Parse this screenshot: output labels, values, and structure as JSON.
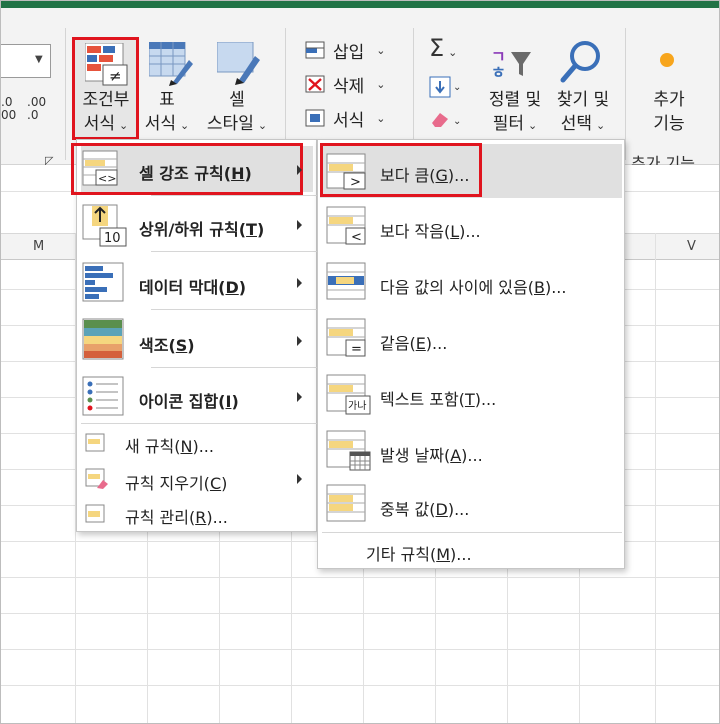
{
  "ribbon": {
    "decimal_increase": ".0\n00",
    "decimal_decrease": ".00\n→.0",
    "conditional_formatting": {
      "line1": "조건부",
      "line2": "서식"
    },
    "format_as_table": {
      "line1": "표",
      "line2": "서식"
    },
    "cell_styles": {
      "line1": "셀",
      "line2": "스타일"
    },
    "insert": "삽입",
    "delete": "삭제",
    "format": "서식",
    "sigma": "Σ",
    "sort_filter": {
      "line1": "정렬 및",
      "line2": "필터"
    },
    "find_select": {
      "line1": "찾기 및",
      "line2": "선택"
    },
    "addins": {
      "line1": "추가",
      "line2": "기능"
    },
    "addins_group_label": "추가 기능"
  },
  "columns": {
    "m": "M",
    "v": "V"
  },
  "menu_main": {
    "highlight_rules": {
      "label": "셀 강조 규칙(",
      "key": "H",
      "end": ")"
    },
    "top_bottom": {
      "label": "상위/하위 규칙(",
      "key": "T",
      "end": ")"
    },
    "data_bars": {
      "label": "데이터 막대(",
      "key": "D",
      "end": ")"
    },
    "color_scales": {
      "label": "색조(",
      "key": "S",
      "end": ")"
    },
    "icon_sets": {
      "label": "아이콘 집합(",
      "key": "I",
      "end": ")"
    },
    "new_rule": {
      "label": "새 규칙(",
      "key": "N",
      "end": ")..."
    },
    "clear_rules": {
      "label": "규칙 지우기(",
      "key": "C",
      "end": ")"
    },
    "manage_rules": {
      "label": "규칙 관리(",
      "key": "R",
      "end": ")..."
    },
    "top10_text": "10"
  },
  "menu_sub": {
    "greater_than": {
      "label": "보다 큼(",
      "key": "G",
      "end": ")..."
    },
    "less_than": {
      "label": "보다 작음(",
      "key": "L",
      "end": ")..."
    },
    "between": {
      "label": "다음 값의 사이에 있음(",
      "key": "B",
      "end": ")..."
    },
    "equal_to": {
      "label": "같음(",
      "key": "E",
      "end": ")..."
    },
    "text_contains": {
      "label": "텍스트 포함(",
      "key": "T",
      "end": ")..."
    },
    "date_occurring": {
      "label": "발생 날짜(",
      "key": "A",
      "end": ")..."
    },
    "duplicate_values": {
      "label": "중복 값(",
      "key": "D",
      "end": ")..."
    },
    "more_rules": {
      "label": "기타 규칙(",
      "key": "M",
      "end": ")..."
    },
    "text_icon_glyph": "가나"
  },
  "colors": {
    "highlight_red": "#e0141e",
    "excel_green": "#217346",
    "bar_yellow": "#f5d67f",
    "bar_blue": "#3a6fb8"
  }
}
